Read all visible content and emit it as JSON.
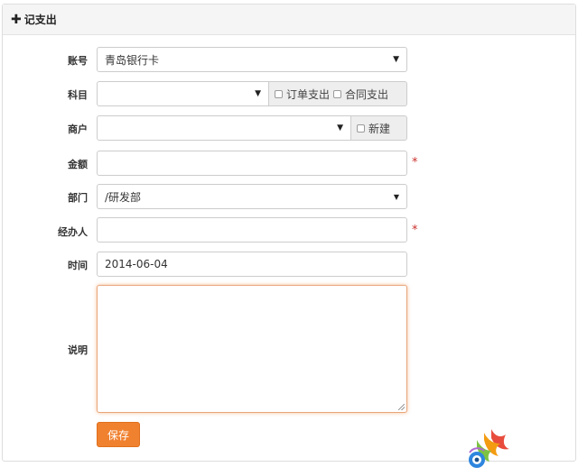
{
  "panel": {
    "title": "记支出"
  },
  "form": {
    "account": {
      "label": "账号",
      "value": "青岛银行卡"
    },
    "subject": {
      "label": "科目",
      "value": "",
      "option_order": "订单支出",
      "option_contract": "合同支出"
    },
    "merchant": {
      "label": "商户",
      "value": "",
      "option_new": "新建"
    },
    "amount": {
      "label": "金额",
      "value": "",
      "required_mark": "*"
    },
    "department": {
      "label": "部门",
      "value": "/研发部"
    },
    "handler": {
      "label": "经办人",
      "value": "",
      "required_mark": "*"
    },
    "time": {
      "label": "时间",
      "value": "2014-06-04"
    },
    "note": {
      "label": "说明",
      "value": ""
    },
    "save_label": "保存"
  },
  "colors": {
    "accent": "#f0812f",
    "required": "#c9302c",
    "heading_bg": "#f5f5f5",
    "border": "#cccccc"
  },
  "icons": [
    "plus-icon",
    "dropdown-caret-icon",
    "checkbox-icon",
    "resize-grip-icon",
    "app-logo"
  ]
}
